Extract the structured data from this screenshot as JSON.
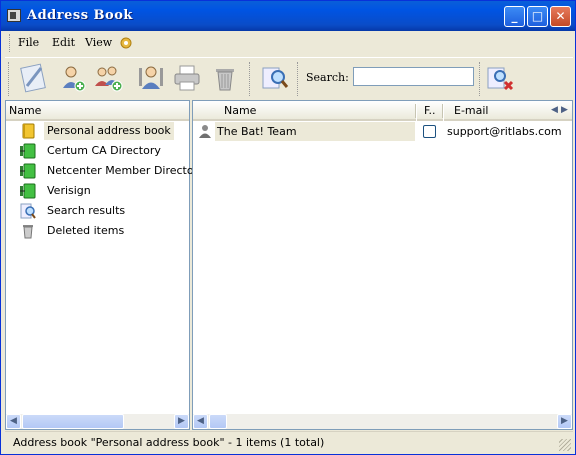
{
  "window": {
    "title": "Address Book"
  },
  "menu": {
    "file": "File",
    "edit": "Edit",
    "view": "View"
  },
  "toolbar": {
    "icons": [
      "new-contact-icon",
      "add-user-icon",
      "add-group-icon",
      "properties-icon",
      "print-icon",
      "delete-icon",
      "find-icon",
      "clear-search-icon"
    ],
    "search_label": "Search:",
    "search_value": ""
  },
  "tree": {
    "header": "Name",
    "items": [
      {
        "label": "Personal address book",
        "icon": "book-icon",
        "selected": true
      },
      {
        "label": "Certum CA Directory",
        "icon": "ldap-directory-icon"
      },
      {
        "label": "Netcenter Member Directory",
        "icon": "ldap-directory-icon"
      },
      {
        "label": "Verisign",
        "icon": "ldap-directory-icon"
      },
      {
        "label": "Search results",
        "icon": "search-results-icon"
      },
      {
        "label": "Deleted items",
        "icon": "trash-icon"
      }
    ]
  },
  "contacts": {
    "columns": {
      "name": "Name",
      "f": "F..",
      "email": "E-mail"
    },
    "rows": [
      {
        "name": "The Bat! Team",
        "email": "support@ritlabs.com",
        "flag": false
      }
    ]
  },
  "status": "Address book \"Personal address book\" - 1 items (1 total)",
  "colors": {
    "title_blue": "#0054e3",
    "border": "#7f9db9"
  }
}
